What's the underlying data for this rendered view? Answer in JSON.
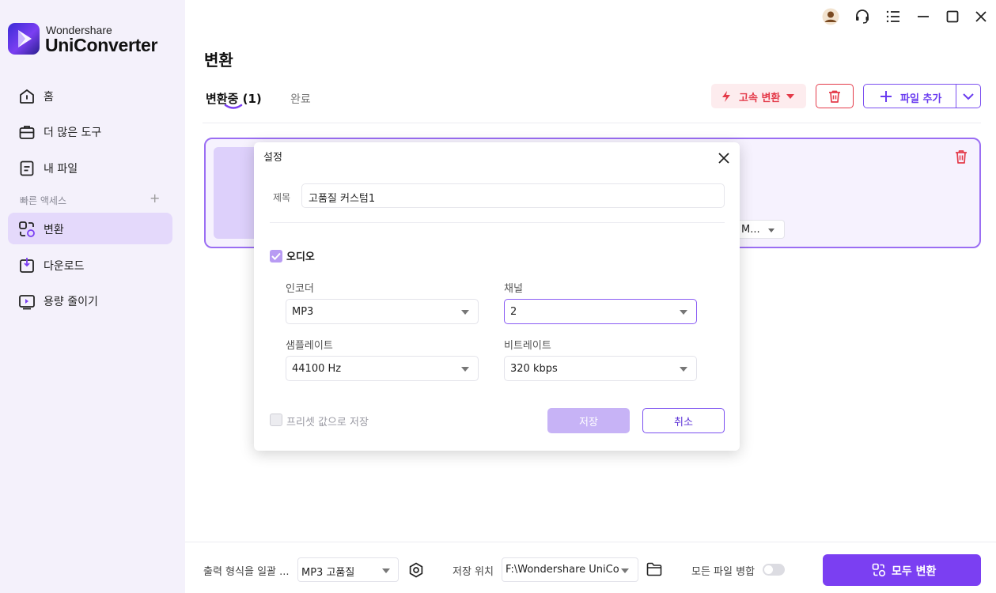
{
  "app": {
    "brand_small": "Wondershare",
    "brand_big": "UniConverter"
  },
  "sidebar": {
    "items": [
      {
        "label": "홈",
        "icon": "home-icon"
      },
      {
        "label": "더 많은 도구",
        "icon": "toolbox-icon"
      },
      {
        "label": "내 파일",
        "icon": "file-icon"
      },
      {
        "label": "변환",
        "icon": "convert-icon",
        "active": true
      },
      {
        "label": "다운로드",
        "icon": "download-icon"
      },
      {
        "label": "용량 줄이기",
        "icon": "compress-icon"
      }
    ],
    "quick_access_label": "빠른 액세스",
    "quick_access_add": "+"
  },
  "header": {
    "title": "변환",
    "tabs": {
      "converting": "변환중 (1)",
      "done": "완료"
    },
    "fast_convert_label": "고속 변환",
    "add_file_label": "파일 추가"
  },
  "file_card": {
    "format_value": "M..."
  },
  "settings_dialog": {
    "title": "설정",
    "name_label": "제목",
    "name_value": "고품질 커스텀1",
    "audio_label": "오디오",
    "audio_checked": true,
    "encoder_label": "인코더",
    "encoder_value": "MP3",
    "channel_label": "채널",
    "channel_value": "2",
    "sample_rate_label": "샘플레이트",
    "sample_rate_value": "44100 Hz",
    "bitrate_label": "비트레이트",
    "bitrate_value": "320 kbps",
    "save_preset_label": "프리셋 값으로 저장",
    "save_button": "저장",
    "cancel_button": "취소"
  },
  "bottom_bar": {
    "output_format_label": "출력 형식을 일괄 ...",
    "output_format_value": "MP3 고품질",
    "save_location_label": "저장 위치",
    "save_location_value": "F:\\Wondershare UniCo",
    "merge_label": "모든 파일 병합",
    "merge_on": false,
    "convert_all_label": "모두 변환"
  },
  "colors": {
    "accent": "#7b3ff2",
    "danger": "#e43b4a",
    "sidebar_bg": "#f4f1fb",
    "active_nav": "#e4d9fb"
  }
}
